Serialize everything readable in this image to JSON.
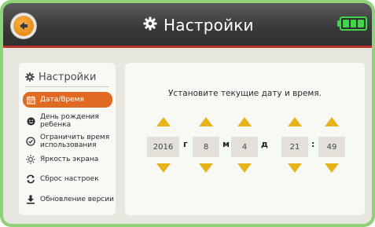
{
  "header": {
    "title": "Настройки",
    "battery_level": "full"
  },
  "sidebar": {
    "title": "Настройки",
    "items": [
      {
        "label": "Дата/Время",
        "icon": "calendar-icon",
        "active": true
      },
      {
        "label": "День рождения\nребенка",
        "icon": "smiley-icon",
        "active": false
      },
      {
        "label": "Ограничить время\nиспользования",
        "icon": "clock-icon",
        "active": false
      },
      {
        "label": "Яркость экрана",
        "icon": "sun-icon",
        "active": false
      },
      {
        "label": "Сброс настроек",
        "icon": "reset-icon",
        "active": false
      },
      {
        "label": "Обновление версии",
        "icon": "download-icon",
        "active": false
      }
    ]
  },
  "main": {
    "instruction": "Установите текущие дату и время.",
    "year": "2016",
    "year_unit": "г",
    "month": "8",
    "month_unit": "м",
    "day": "4",
    "day_unit": "д",
    "hour": "21",
    "time_separator": ":",
    "minute": "49"
  },
  "colors": {
    "accent": "#e06a21",
    "header_line": "#b8322b",
    "arrow": "#e8b21a",
    "frame": "#8fd27a"
  }
}
